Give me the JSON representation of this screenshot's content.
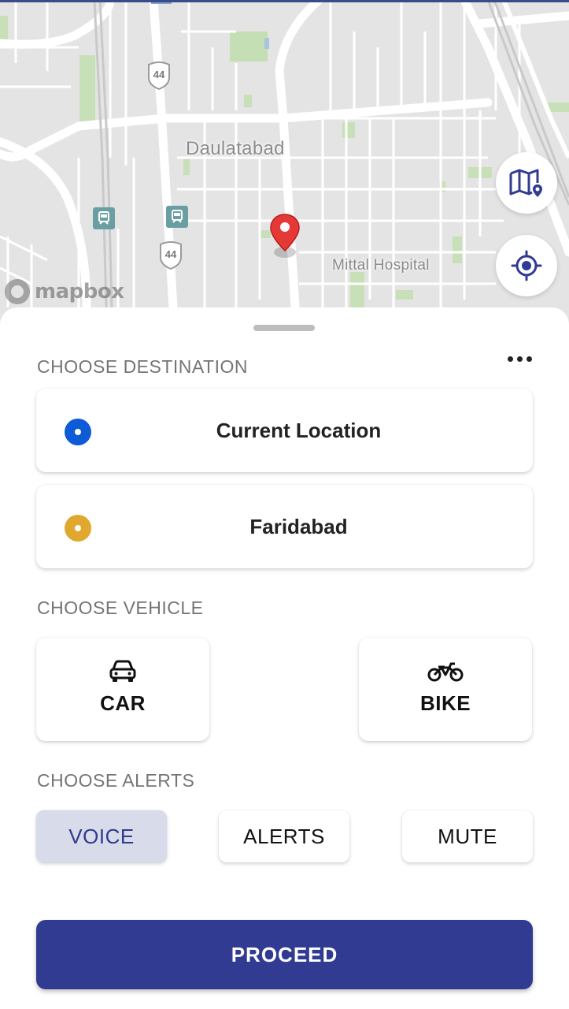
{
  "map": {
    "city_label": "Daulatabad",
    "poi_label": "Mittal Hospital",
    "highway_shields": [
      "44",
      "44"
    ],
    "attribution": "mapbox",
    "buttons": {
      "layers_icon": "map-layers-icon",
      "locate_icon": "my-location-icon"
    },
    "pin_color": "#e53935"
  },
  "sheet": {
    "destination_title": "CHOOSE DESTINATION",
    "destinations": [
      {
        "label": "Current Location",
        "dot_color": "#0d5bd7"
      },
      {
        "label": "Faridabad",
        "dot_color": "#e0a82e"
      }
    ],
    "vehicle_title": "CHOOSE VEHICLE",
    "vehicles": [
      {
        "label": "CAR",
        "icon": "car-icon"
      },
      {
        "label": "BIKE",
        "icon": "bike-icon"
      }
    ],
    "alerts_title": "CHOOSE ALERTS",
    "alerts": [
      {
        "label": "VOICE",
        "selected": true
      },
      {
        "label": "ALERTS",
        "selected": false
      },
      {
        "label": "MUTE",
        "selected": false
      }
    ],
    "proceed_label": "PROCEED"
  },
  "colors": {
    "primary": "#303b91",
    "selected_bg": "#d8dbe9",
    "section_title": "#757575"
  }
}
